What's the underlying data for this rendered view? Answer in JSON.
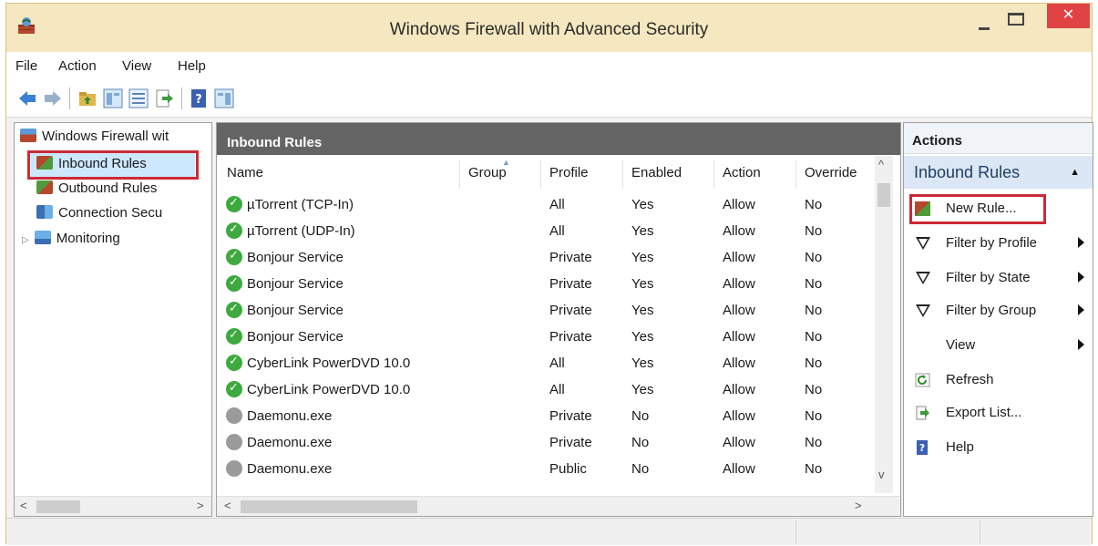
{
  "window": {
    "title": "Windows Firewall with Advanced Security",
    "close_label": "✕"
  },
  "menu": {
    "items": [
      "File",
      "Action",
      "View",
      "Help"
    ]
  },
  "tree": {
    "root": "Windows Firewall wit",
    "items": [
      "Inbound Rules",
      "Outbound Rules",
      "Connection Secu",
      "Monitoring"
    ]
  },
  "center": {
    "header": "Inbound Rules",
    "columns": [
      "Name",
      "Group",
      "Profile",
      "Enabled",
      "Action",
      "Override"
    ],
    "rows": [
      {
        "name": "µTorrent (TCP-In)",
        "profile": "All",
        "enabled": "Yes",
        "action": "Allow",
        "override": "No",
        "status": "enabled"
      },
      {
        "name": "µTorrent (UDP-In)",
        "profile": "All",
        "enabled": "Yes",
        "action": "Allow",
        "override": "No",
        "status": "enabled"
      },
      {
        "name": "Bonjour Service",
        "profile": "Private",
        "enabled": "Yes",
        "action": "Allow",
        "override": "No",
        "status": "enabled"
      },
      {
        "name": "Bonjour Service",
        "profile": "Private",
        "enabled": "Yes",
        "action": "Allow",
        "override": "No",
        "status": "enabled"
      },
      {
        "name": "Bonjour Service",
        "profile": "Private",
        "enabled": "Yes",
        "action": "Allow",
        "override": "No",
        "status": "enabled"
      },
      {
        "name": "Bonjour Service",
        "profile": "Private",
        "enabled": "Yes",
        "action": "Allow",
        "override": "No",
        "status": "enabled"
      },
      {
        "name": "CyberLink PowerDVD 10.0",
        "profile": "All",
        "enabled": "Yes",
        "action": "Allow",
        "override": "No",
        "status": "enabled"
      },
      {
        "name": "CyberLink PowerDVD 10.0",
        "profile": "All",
        "enabled": "Yes",
        "action": "Allow",
        "override": "No",
        "status": "enabled"
      },
      {
        "name": "Daemonu.exe",
        "profile": "Private",
        "enabled": "No",
        "action": "Allow",
        "override": "No",
        "status": "disabled"
      },
      {
        "name": "Daemonu.exe",
        "profile": "Private",
        "enabled": "No",
        "action": "Allow",
        "override": "No",
        "status": "disabled"
      },
      {
        "name": "Daemonu.exe",
        "profile": "Public",
        "enabled": "No",
        "action": "Allow",
        "override": "No",
        "status": "disabled"
      }
    ]
  },
  "actions": {
    "header": "Actions",
    "section": "Inbound Rules",
    "items": [
      {
        "label": "New Rule...",
        "icon": "new-rule-icon"
      },
      {
        "label": "Filter by Profile",
        "icon": "filter-icon"
      },
      {
        "label": "Filter by State",
        "icon": "filter-icon"
      },
      {
        "label": "Filter by Group",
        "icon": "filter-icon"
      },
      {
        "label": "View",
        "icon": ""
      },
      {
        "label": "Refresh",
        "icon": "refresh-icon"
      },
      {
        "label": "Export List...",
        "icon": "export-icon"
      },
      {
        "label": "Help",
        "icon": "help-icon"
      }
    ]
  },
  "colors": {
    "titlebar": "#f5e8c0",
    "close": "#e04343",
    "highlight": "#cc2a36",
    "selection": "#cce8ff",
    "enabled_icon": "#3ea93e"
  }
}
